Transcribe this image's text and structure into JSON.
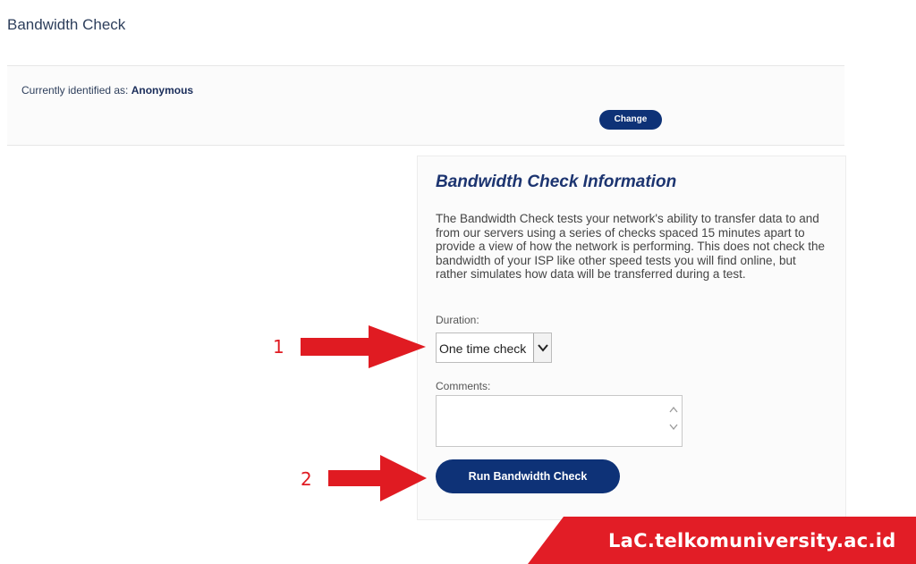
{
  "page": {
    "title": "Bandwidth Check"
  },
  "identity": {
    "label": "Currently identified as:",
    "name": "Anonymous",
    "change_label": "Change"
  },
  "info": {
    "title": "Bandwidth Check Information",
    "description": "The Bandwidth Check tests your network's ability to transfer data to and from our servers using a series of checks spaced 15 minutes apart to provide a view of how the network is performing. This does not check the bandwidth of your ISP like other speed tests you will find online, but rather simulates how data will be transferred during a test.",
    "duration_label": "Duration:",
    "duration_value": "One time check",
    "comments_label": "Comments:",
    "comments_value": "",
    "run_label": "Run Bandwidth Check"
  },
  "annotations": {
    "step1": "1",
    "step2": "2",
    "arrow_color": "#e01b22"
  },
  "watermark": {
    "text": "LaC.telkomuniversity.ac.id",
    "color": "#e21d26"
  },
  "icons": {
    "select_arrow": "chevron-down-icon",
    "scroll": "scroll-arrows-icon"
  }
}
